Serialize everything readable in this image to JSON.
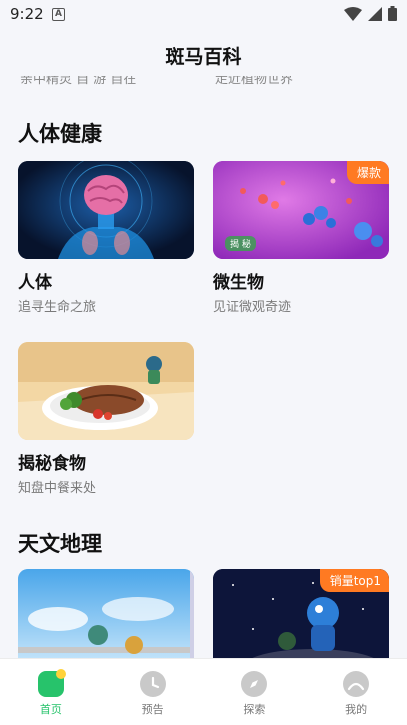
{
  "status_bar": {
    "time": "9:22",
    "notification_icon_letter": "A"
  },
  "header": {
    "title": "斑马百科"
  },
  "peek_text": {
    "left": "亲中精灵 自 游 自在",
    "right": "走近植物世界"
  },
  "sections": [
    {
      "title": "人体健康",
      "cards": [
        {
          "title": "人体",
          "subtitle": "追寻生命之旅",
          "badge": "",
          "image_icon": "human-body-illustration"
        },
        {
          "title": "微生物",
          "subtitle": "见证微观奇迹",
          "badge": "爆款",
          "image_icon": "microbes-illustration",
          "image_caption": "揭 秘"
        },
        {
          "title": "揭秘食物",
          "subtitle": "知盘中餐来处",
          "badge": "",
          "image_icon": "steak-plate-illustration"
        }
      ]
    },
    {
      "title": "天文地理",
      "cards": [
        {
          "title": "",
          "subtitle": "",
          "badge": "",
          "image_icon": "sky-characters-illustration"
        },
        {
          "title": "",
          "subtitle": "",
          "badge": "销量top1",
          "image_icon": "space-astronaut-illustration"
        }
      ]
    }
  ],
  "tabbar": {
    "tabs": [
      {
        "label": "首页",
        "icon": "home-icon",
        "active": true
      },
      {
        "label": "预告",
        "icon": "clock-icon",
        "active": false
      },
      {
        "label": "探索",
        "icon": "compass-icon",
        "active": false
      },
      {
        "label": "我的",
        "icon": "profile-icon",
        "active": false
      }
    ]
  },
  "colors": {
    "accent": "#27c36b",
    "badge": "#ff7a22",
    "background": "#f5f6fa"
  }
}
